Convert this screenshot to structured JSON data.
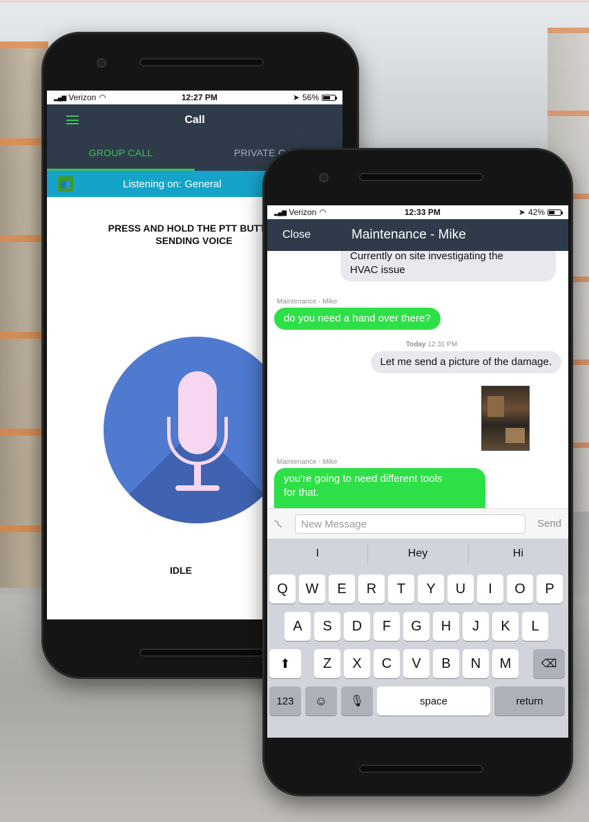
{
  "left_phone": {
    "status": {
      "carrier": "Verizon",
      "time": "12:27 PM",
      "battery": "56%",
      "battery_level": 0.56
    },
    "appbar": {
      "title": "Call",
      "menu_icon": "hamburger-menu-icon"
    },
    "tabs": [
      {
        "label": "GROUP CALL",
        "active": true
      },
      {
        "label": "PRIVATE CALL",
        "active": false
      }
    ],
    "listening": {
      "label": "Listening on:  General",
      "icon": "group-icon"
    },
    "instruction_line1": "PRESS AND HOLD THE PTT BUTTON",
    "instruction_line2": "SENDING VOICE",
    "mic_icon": "microphone-icon",
    "state": "IDLE",
    "colors": {
      "accent": "#3dc15a",
      "bar": "#2f3b4a",
      "listen_bar": "#16a3c9",
      "mic_circle": "#4f7acf"
    }
  },
  "right_phone": {
    "status": {
      "carrier": "Verizon",
      "time": "12:33 PM",
      "battery": "42%",
      "battery_level": 0.42
    },
    "navbar": {
      "close": "Close",
      "title": "Maintenance - Mike"
    },
    "messages": [
      {
        "type": "outgoing",
        "text_line1": "Currently on site investigating the",
        "text_line2": "HVAC issue"
      },
      {
        "type": "incoming",
        "sender": "Maintenance - Mike",
        "text": "do you need a hand over there?"
      },
      {
        "type": "timestamp",
        "day": "Today",
        "time": "12:31 PM"
      },
      {
        "type": "outgoing",
        "text": "Let me send a picture of the damage."
      },
      {
        "type": "outgoing-image"
      },
      {
        "type": "incoming",
        "sender": "Maintenance - Mike",
        "text_line1": "you're going to need different tools",
        "text_line2": "for that."
      }
    ],
    "composer": {
      "placeholder": "New Message",
      "send": "Send",
      "attach_icon": "paperclip-icon"
    },
    "keyboard": {
      "predictions": [
        "I",
        "Hey",
        "Hi"
      ],
      "row1": [
        "Q",
        "W",
        "E",
        "R",
        "T",
        "Y",
        "U",
        "I",
        "O",
        "P"
      ],
      "row2": [
        "A",
        "S",
        "D",
        "F",
        "G",
        "H",
        "J",
        "K",
        "L"
      ],
      "row3": [
        "Z",
        "X",
        "C",
        "V",
        "B",
        "N",
        "M"
      ],
      "shift_icon": "shift-arrow-icon",
      "delete_icon": "backspace-icon",
      "numbers": "123",
      "emoji_icon": "emoji-icon",
      "dictation_icon": "microphone-icon",
      "space": "space",
      "return": "return"
    },
    "colors": {
      "green_bubble": "#2ee047",
      "gray_bubble": "#e8e8ed"
    }
  }
}
